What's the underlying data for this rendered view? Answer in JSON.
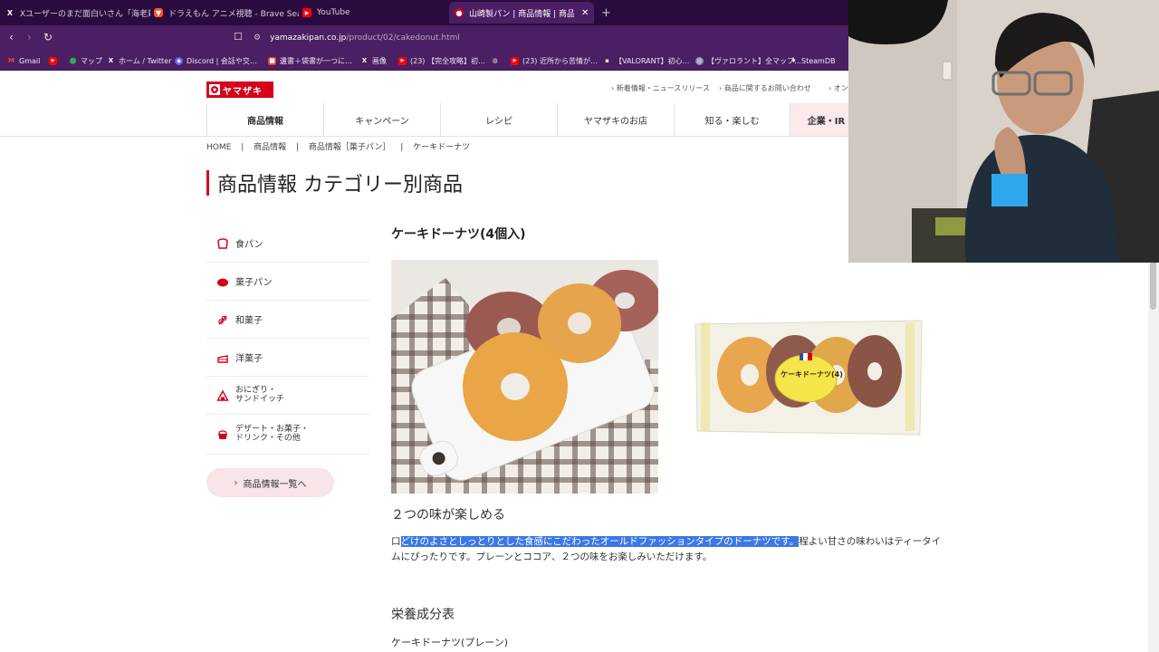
{
  "tabs": [
    {
      "label": "Xユーザーのまだ面白いさん「海老蔵が下」",
      "icon": "x-icon"
    },
    {
      "label": "ドラえもん アニメ視聴 - Brave Search",
      "icon": "brave-icon"
    },
    {
      "label": "YouTube",
      "icon": "youtube-icon"
    },
    {
      "label": "山崎製パン | 商品情報 | 商品情報",
      "icon": "yamazaki-icon",
      "active": true
    }
  ],
  "new_tab": "+",
  "address": {
    "domain": "yamazakipan.co.jp",
    "path": "/product/02/cakedonut.html"
  },
  "bookmarks": [
    {
      "label": "Gmail",
      "icon": "gmail-icon"
    },
    {
      "label": "",
      "icon": "youtube-icon"
    },
    {
      "label": "マップ",
      "icon": "maps-icon"
    },
    {
      "label": "ホーム / Twitter",
      "icon": "x-icon"
    },
    {
      "label": "Discord | 会話や交…",
      "icon": "discord-icon"
    },
    {
      "label": "遺書＋袋書が一つに…",
      "icon": "bookmark-icon"
    },
    {
      "label": "画像",
      "icon": "x-icon"
    },
    {
      "label": "(23) 【完全攻略】初…",
      "icon": "youtube-icon"
    },
    {
      "label": "",
      "icon": "globe-icon"
    },
    {
      "label": "(23) 近所から苦情が…",
      "icon": "youtube-icon"
    },
    {
      "label": "【VALORANT】初心…",
      "icon": "bookmark-icon"
    },
    {
      "label": "【ヴァロラント】全マップ…",
      "icon": "bookmark-icon"
    },
    {
      "label": "SteamDB",
      "icon": "steam-icon"
    }
  ],
  "site": {
    "logo_text": "ヤマザキ",
    "util_links": [
      "新着情報・ニュースリリース",
      "商品に関するお問い合わせ",
      "オン"
    ],
    "nav": [
      "商品情報",
      "キャンペーン",
      "レシピ",
      "ヤマザキのお店",
      "知る・楽しむ",
      "企業・IR"
    ],
    "breadcrumb": [
      "HOME",
      "商品情報",
      "商品情報［菓子パン］",
      "ケーキドーナツ"
    ],
    "breadcrumb_sep": "|",
    "page_title": "商品情報 カテゴリー別商品"
  },
  "sidebar": {
    "items": [
      {
        "label": "食パン",
        "icon": "bread-icon"
      },
      {
        "label": "菓子パン",
        "icon": "sweet-bun-icon"
      },
      {
        "label": "和菓子",
        "icon": "wagashi-icon"
      },
      {
        "label": "洋菓子",
        "icon": "cake-icon"
      },
      {
        "label": "おにぎり・\nサンドイッチ",
        "icon": "onigiri-icon"
      },
      {
        "label": "デザート・お菓子・\nドリンク・その他",
        "icon": "dessert-icon"
      }
    ],
    "list_button": "商品情報一覧へ"
  },
  "product": {
    "name": "ケーキドーナツ(4個入)",
    "package_label": "ケーキドーナツ(4)",
    "subheading": "２つの味が楽しめる",
    "desc_first_char": "口",
    "desc_selected": "どけのよさとしっとりとした食感にこだわったオールドファッションタイプのドーナツです。",
    "desc_rest": "程よい甘さの味わいはティータイムにぴったりです。プレーンとココア、２つの味をお楽しみいただけます。",
    "nutrition_heading": "栄養成分表",
    "nutrition_sub": "ケーキドーナツ(プレーン)"
  },
  "colors": {
    "brand_red": "#d7001b",
    "tab_bg": "#2a0b3d",
    "toolbar_bg": "#4b1f63",
    "selection": "#3b78e7"
  }
}
